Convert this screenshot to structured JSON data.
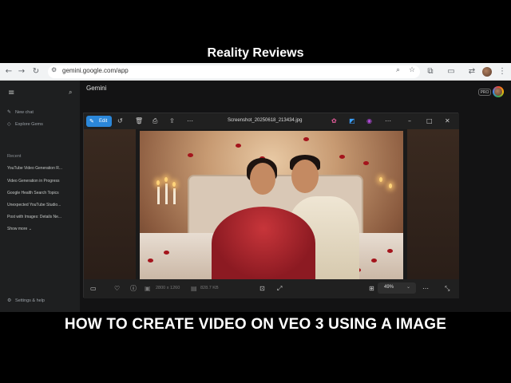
{
  "banner": {
    "top": "Reality Reviews",
    "bottom": "HOW TO CREATE VIDEO ON VEO 3 USING A IMAGE"
  },
  "browser": {
    "url": "gemini.google.com/app",
    "icons": {
      "back": "arrow-left-icon",
      "forward": "arrow-right-icon",
      "reload": "reload-icon",
      "site_info": "tune-icon",
      "zoom": "magnifier-icon",
      "bookmark": "star-icon",
      "extensions": "puzzle-icon",
      "cast": "cast-icon",
      "translate": "translate-icon",
      "menu": "kebab-icon"
    }
  },
  "gemini": {
    "title": "Gemini",
    "pro_badge": "PRO",
    "sidebar": {
      "new_chat": "New chat",
      "explore_gems": "Explore Gems",
      "recent_heading": "Recent",
      "recent_items": [
        "YouTube Video Generation R...",
        "Video Generation in Progress",
        "Google Health Search Topics",
        "Unexpected YouTube Studio...",
        "Post with Images: Details Ne..."
      ],
      "show_more": "Show more",
      "settings": "Settings & help"
    }
  },
  "viewer": {
    "edit_label": "Edit",
    "filename": "Screenshot_20250618_213434.jpg",
    "dimensions": "2800 x 1260",
    "file_size": "828.7 KB",
    "zoom": "49%"
  },
  "colors": {
    "accent_blue": "#2b87d9",
    "page_bg": "#131314",
    "sidebar_bg": "#1e1f20",
    "viewer_bg": "#202020"
  }
}
